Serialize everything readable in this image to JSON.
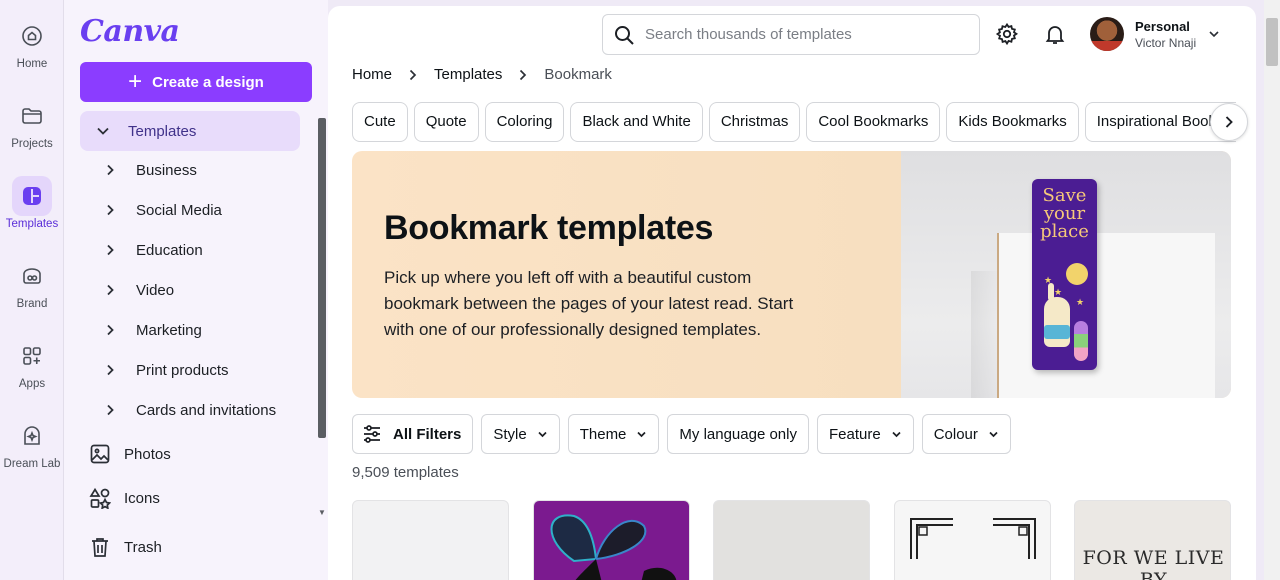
{
  "rail": {
    "items": [
      {
        "label": "Home",
        "icon": "home-icon"
      },
      {
        "label": "Projects",
        "icon": "folder-icon"
      },
      {
        "label": "Templates",
        "icon": "templates-icon",
        "active": true
      },
      {
        "label": "Brand",
        "icon": "brand-icon"
      },
      {
        "label": "Apps",
        "icon": "apps-icon"
      },
      {
        "label": "Dream Lab",
        "icon": "dream-lab-icon"
      }
    ]
  },
  "panel": {
    "logo": "Canva",
    "create_label": "Create a design",
    "templates_label": "Templates",
    "categories": [
      "Business",
      "Social Media",
      "Education",
      "Video",
      "Marketing",
      "Print products",
      "Cards and invitations"
    ],
    "photos_label": "Photos",
    "icons_label": "Icons",
    "trash_label": "Trash"
  },
  "header": {
    "search_placeholder": "Search thousands of templates",
    "account_type": "Personal",
    "account_name": "Victor Nnaji"
  },
  "breadcrumb": [
    "Home",
    "Templates",
    "Bookmark"
  ],
  "chips": [
    "Cute",
    "Quote",
    "Coloring",
    "Black and White",
    "Christmas",
    "Cool Bookmarks",
    "Kids Bookmarks",
    "Inspirational Bookmarks"
  ],
  "hero": {
    "title": "Bookmark templates",
    "description": "Pick up where you left off with a beautiful custom bookmark between the pages of your latest read. Start with one of our professionally designed templates.",
    "bookmark_text": "Save your place"
  },
  "filters": {
    "all_label": "All Filters",
    "dropdowns": [
      "Style",
      "Theme",
      "My language only",
      "Feature",
      "Colour"
    ]
  },
  "results": {
    "count_label": "9,509 templates",
    "thumb5_text": "FOR WE LIVE BY"
  },
  "colors": {
    "brand_purple": "#8b3dff",
    "active_bg": "#e8dcfb"
  }
}
